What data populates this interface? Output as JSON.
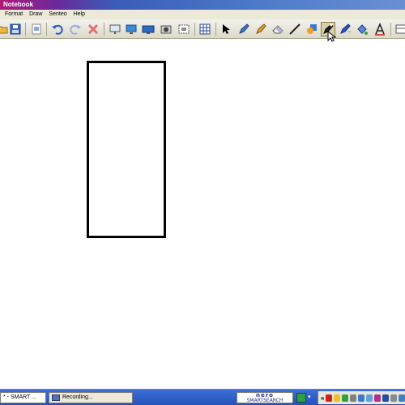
{
  "window": {
    "title": "Notebook"
  },
  "menu": {
    "items": [
      "Format",
      "Draw",
      "Senteo",
      "Help"
    ]
  },
  "toolbar": {
    "buttons": [
      "folder-icon",
      "save-icon",
      "page-icon",
      "undo-icon",
      "redo-icon",
      "delete-icon",
      "screen-shade-icon",
      "display-icon",
      "dual-display-icon",
      "capture-icon",
      "capture-area-icon",
      "table-icon",
      "select-arrow-icon",
      "pen-icon",
      "creative-pen-icon",
      "eraser-icon",
      "line-icon",
      "shapes-icon",
      "magic-pen-icon",
      "shape-recognition-pen-icon",
      "fill-icon",
      "text-icon"
    ],
    "active_tool": "magic-pen-icon"
  },
  "taskbar": {
    "tasks": [
      {
        "label": "* - SMART ..."
      },
      {
        "label": "Recording..."
      }
    ],
    "nero": {
      "line1": "nero",
      "line2": "SMARTSEARCH"
    },
    "tray_chevron": "«"
  },
  "colors": {
    "title_start": "#b0187a",
    "title_end": "#4a78c8",
    "taskbar": "#2452b8",
    "shape_stroke": "#000000"
  }
}
